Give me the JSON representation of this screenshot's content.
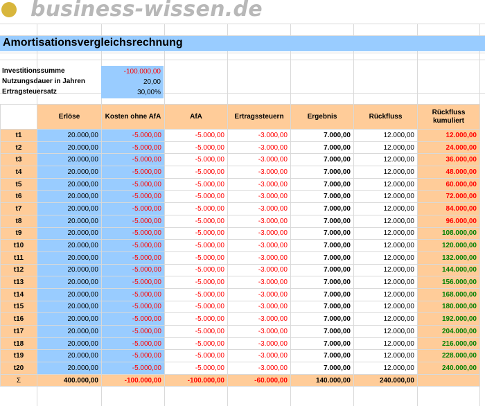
{
  "logo": {
    "text": "business-wissen.de"
  },
  "title": "Amortisationsvergleichsrechnung",
  "params": [
    {
      "label": "Investitionssumme",
      "value": "-100.000,00",
      "color": "#ff0000"
    },
    {
      "label": "Nutzungsdauer in Jahren",
      "value": "20,00",
      "color": "#000000"
    },
    {
      "label": "Ertragsteuersatz",
      "value": "30,00%",
      "color": "#000000"
    }
  ],
  "headers": [
    "",
    "Erlöse",
    "Kosten ohne AfA",
    "AfA",
    "Ertragssteuern",
    "Ergebnis",
    "Rückfluss",
    "Rückfluss kumuliert"
  ],
  "rows": [
    {
      "label": "t1",
      "erloese": "20.000,00",
      "kosten": "-5.000,00",
      "afa": "-5.000,00",
      "steuern": "-3.000,00",
      "ergebnis": "7.000,00",
      "rueckfluss": "12.000,00",
      "kumuliert": "12.000,00",
      "kum_positive": false
    },
    {
      "label": "t2",
      "erloese": "20.000,00",
      "kosten": "-5.000,00",
      "afa": "-5.000,00",
      "steuern": "-3.000,00",
      "ergebnis": "7.000,00",
      "rueckfluss": "12.000,00",
      "kumuliert": "24.000,00",
      "kum_positive": false
    },
    {
      "label": "t3",
      "erloese": "20.000,00",
      "kosten": "-5.000,00",
      "afa": "-5.000,00",
      "steuern": "-3.000,00",
      "ergebnis": "7.000,00",
      "rueckfluss": "12.000,00",
      "kumuliert": "36.000,00",
      "kum_positive": false
    },
    {
      "label": "t4",
      "erloese": "20.000,00",
      "kosten": "-5.000,00",
      "afa": "-5.000,00",
      "steuern": "-3.000,00",
      "ergebnis": "7.000,00",
      "rueckfluss": "12.000,00",
      "kumuliert": "48.000,00",
      "kum_positive": false
    },
    {
      "label": "t5",
      "erloese": "20.000,00",
      "kosten": "-5.000,00",
      "afa": "-5.000,00",
      "steuern": "-3.000,00",
      "ergebnis": "7.000,00",
      "rueckfluss": "12.000,00",
      "kumuliert": "60.000,00",
      "kum_positive": false
    },
    {
      "label": "t6",
      "erloese": "20.000,00",
      "kosten": "-5.000,00",
      "afa": "-5.000,00",
      "steuern": "-3.000,00",
      "ergebnis": "7.000,00",
      "rueckfluss": "12.000,00",
      "kumuliert": "72.000,00",
      "kum_positive": false
    },
    {
      "label": "t7",
      "erloese": "20.000,00",
      "kosten": "-5.000,00",
      "afa": "-5.000,00",
      "steuern": "-3.000,00",
      "ergebnis": "7.000,00",
      "rueckfluss": "12.000,00",
      "kumuliert": "84.000,00",
      "kum_positive": false
    },
    {
      "label": "t8",
      "erloese": "20.000,00",
      "kosten": "-5.000,00",
      "afa": "-5.000,00",
      "steuern": "-3.000,00",
      "ergebnis": "7.000,00",
      "rueckfluss": "12.000,00",
      "kumuliert": "96.000,00",
      "kum_positive": false
    },
    {
      "label": "t9",
      "erloese": "20.000,00",
      "kosten": "-5.000,00",
      "afa": "-5.000,00",
      "steuern": "-3.000,00",
      "ergebnis": "7.000,00",
      "rueckfluss": "12.000,00",
      "kumuliert": "108.000,00",
      "kum_positive": true
    },
    {
      "label": "t10",
      "erloese": "20.000,00",
      "kosten": "-5.000,00",
      "afa": "-5.000,00",
      "steuern": "-3.000,00",
      "ergebnis": "7.000,00",
      "rueckfluss": "12.000,00",
      "kumuliert": "120.000,00",
      "kum_positive": true
    },
    {
      "label": "t11",
      "erloese": "20.000,00",
      "kosten": "-5.000,00",
      "afa": "-5.000,00",
      "steuern": "-3.000,00",
      "ergebnis": "7.000,00",
      "rueckfluss": "12.000,00",
      "kumuliert": "132.000,00",
      "kum_positive": true
    },
    {
      "label": "t12",
      "erloese": "20.000,00",
      "kosten": "-5.000,00",
      "afa": "-5.000,00",
      "steuern": "-3.000,00",
      "ergebnis": "7.000,00",
      "rueckfluss": "12.000,00",
      "kumuliert": "144.000,00",
      "kum_positive": true
    },
    {
      "label": "t13",
      "erloese": "20.000,00",
      "kosten": "-5.000,00",
      "afa": "-5.000,00",
      "steuern": "-3.000,00",
      "ergebnis": "7.000,00",
      "rueckfluss": "12.000,00",
      "kumuliert": "156.000,00",
      "kum_positive": true
    },
    {
      "label": "t14",
      "erloese": "20.000,00",
      "kosten": "-5.000,00",
      "afa": "-5.000,00",
      "steuern": "-3.000,00",
      "ergebnis": "7.000,00",
      "rueckfluss": "12.000,00",
      "kumuliert": "168.000,00",
      "kum_positive": true
    },
    {
      "label": "t15",
      "erloese": "20.000,00",
      "kosten": "-5.000,00",
      "afa": "-5.000,00",
      "steuern": "-3.000,00",
      "ergebnis": "7.000,00",
      "rueckfluss": "12.000,00",
      "kumuliert": "180.000,00",
      "kum_positive": true
    },
    {
      "label": "t16",
      "erloese": "20.000,00",
      "kosten": "-5.000,00",
      "afa": "-5.000,00",
      "steuern": "-3.000,00",
      "ergebnis": "7.000,00",
      "rueckfluss": "12.000,00",
      "kumuliert": "192.000,00",
      "kum_positive": true
    },
    {
      "label": "t17",
      "erloese": "20.000,00",
      "kosten": "-5.000,00",
      "afa": "-5.000,00",
      "steuern": "-3.000,00",
      "ergebnis": "7.000,00",
      "rueckfluss": "12.000,00",
      "kumuliert": "204.000,00",
      "kum_positive": true
    },
    {
      "label": "t18",
      "erloese": "20.000,00",
      "kosten": "-5.000,00",
      "afa": "-5.000,00",
      "steuern": "-3.000,00",
      "ergebnis": "7.000,00",
      "rueckfluss": "12.000,00",
      "kumuliert": "216.000,00",
      "kum_positive": true
    },
    {
      "label": "t19",
      "erloese": "20.000,00",
      "kosten": "-5.000,00",
      "afa": "-5.000,00",
      "steuern": "-3.000,00",
      "ergebnis": "7.000,00",
      "rueckfluss": "12.000,00",
      "kumuliert": "228.000,00",
      "kum_positive": true
    },
    {
      "label": "t20",
      "erloese": "20.000,00",
      "kosten": "-5.000,00",
      "afa": "-5.000,00",
      "steuern": "-3.000,00",
      "ergebnis": "7.000,00",
      "rueckfluss": "12.000,00",
      "kumuliert": "240.000,00",
      "kum_positive": true
    }
  ],
  "totals": {
    "symbol": "Σ",
    "erloese": "400.000,00",
    "kosten": "-100.000,00",
    "afa": "-100.000,00",
    "steuern": "-60.000,00",
    "ergebnis": "140.000,00",
    "rueckfluss": "240.000,00",
    "kumuliert": ""
  },
  "colors": {
    "blue_fill": "#99ccff",
    "orange_fill": "#ffcc99",
    "negative": "#ff0000",
    "positive": "#008000"
  }
}
